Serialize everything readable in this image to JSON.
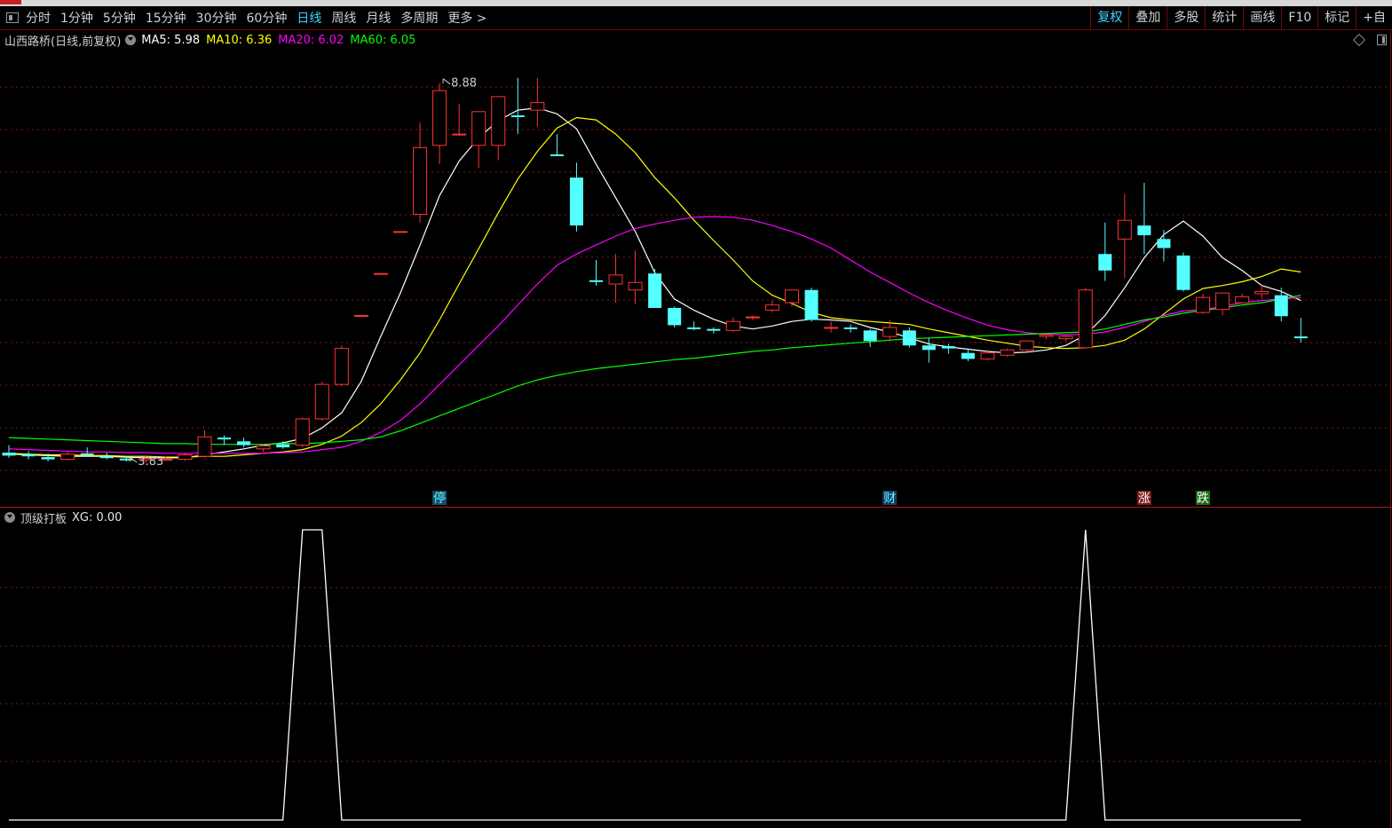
{
  "toolbar": {
    "periods": [
      "分时",
      "1分钟",
      "5分钟",
      "15分钟",
      "30分钟",
      "60分钟",
      "日线",
      "周线",
      "月线",
      "多周期",
      "更多 >"
    ],
    "active_period": "日线",
    "right_buttons": [
      "复权",
      "叠加",
      "多股",
      "统计",
      "画线",
      "F10",
      "标记",
      "+自"
    ],
    "active_right": "复权"
  },
  "info": {
    "title": "山西路桥(日线,前复权)",
    "ma": [
      {
        "label": "MA5: 5.98",
        "color": "#ffffff"
      },
      {
        "label": "MA10: 6.36",
        "color": "#ffff00"
      },
      {
        "label": "MA20: 6.02",
        "color": "#ff00ff"
      },
      {
        "label": "MA60: 6.05",
        "color": "#00ff00"
      }
    ]
  },
  "indicator": {
    "title": "顶级打板",
    "value": "XG: 0.00"
  },
  "colors": {
    "up": "#ff3232",
    "down": "#54ffff",
    "ma5": "#ffffff",
    "ma10": "#ffff00",
    "ma20": "#ff00ff",
    "ma60": "#00ff00",
    "grid": "#8b1a1a",
    "border": "#6e0a0a"
  },
  "chart_data": [
    {
      "type": "candlestick",
      "title": "山西路桥(日线,前复权)",
      "ylim": [
        3.5,
        9.35
      ],
      "price_annotations": [
        {
          "label": "8.88",
          "index": 22,
          "price": 8.88
        },
        {
          "label": "3.83",
          "index": 6,
          "price": 3.83
        }
      ],
      "candles": [
        [
          3.95,
          4.05,
          3.88,
          3.91
        ],
        [
          3.93,
          3.97,
          3.86,
          3.9
        ],
        [
          3.89,
          3.94,
          3.83,
          3.86
        ],
        [
          3.86,
          3.96,
          3.84,
          3.93
        ],
        [
          3.94,
          4.02,
          3.9,
          3.92
        ],
        [
          3.9,
          3.95,
          3.86,
          3.88
        ],
        [
          3.87,
          3.9,
          3.83,
          3.86
        ],
        [
          3.85,
          3.88,
          3.82,
          3.87
        ],
        [
          3.86,
          3.9,
          3.84,
          3.86
        ],
        [
          3.86,
          3.94,
          3.84,
          3.92
        ],
        [
          3.9,
          4.25,
          3.88,
          4.16
        ],
        [
          4.15,
          4.18,
          4.05,
          4.14
        ],
        [
          4.1,
          4.15,
          4.02,
          4.05
        ],
        [
          4.0,
          4.06,
          3.96,
          4.04
        ],
        [
          4.06,
          4.1,
          4.0,
          4.02
        ],
        [
          4.05,
          4.42,
          4.02,
          4.4
        ],
        [
          4.4,
          4.9,
          4.38,
          4.86
        ],
        [
          4.86,
          5.38,
          4.84,
          5.34
        ],
        [
          5.78,
          5.78,
          5.78,
          5.78
        ],
        [
          6.34,
          6.34,
          6.34,
          6.34
        ],
        [
          6.9,
          6.9,
          6.9,
          6.9
        ],
        [
          7.13,
          8.35,
          7.02,
          8.02
        ],
        [
          8.05,
          8.88,
          7.8,
          8.78
        ],
        [
          8.2,
          8.6,
          8.18,
          8.2
        ],
        [
          8.05,
          8.45,
          7.75,
          8.5
        ],
        [
          8.05,
          8.62,
          7.85,
          8.7
        ],
        [
          8.45,
          8.95,
          8.2,
          8.43
        ],
        [
          8.52,
          8.95,
          8.3,
          8.62
        ],
        [
          7.93,
          8.2,
          7.92,
          7.92
        ],
        [
          7.62,
          7.82,
          6.9,
          6.98
        ],
        [
          6.25,
          6.52,
          6.18,
          6.24
        ],
        [
          6.2,
          6.6,
          5.95,
          6.32
        ],
        [
          6.12,
          6.65,
          5.93,
          6.22
        ],
        [
          6.34,
          6.4,
          5.88,
          5.88
        ],
        [
          5.88,
          5.9,
          5.62,
          5.65
        ],
        [
          5.62,
          5.7,
          5.58,
          5.6
        ],
        [
          5.6,
          5.62,
          5.54,
          5.58
        ],
        [
          5.58,
          5.75,
          5.56,
          5.7
        ],
        [
          5.75,
          5.78,
          5.72,
          5.76
        ],
        [
          5.85,
          5.98,
          5.82,
          5.92
        ],
        [
          5.95,
          6.1,
          5.9,
          6.12
        ],
        [
          6.12,
          6.15,
          5.7,
          5.72
        ],
        [
          5.62,
          5.7,
          5.55,
          5.62
        ],
        [
          5.62,
          5.66,
          5.55,
          5.6
        ],
        [
          5.58,
          5.6,
          5.36,
          5.44
        ],
        [
          5.5,
          5.72,
          5.45,
          5.62
        ],
        [
          5.58,
          5.62,
          5.35,
          5.38
        ],
        [
          5.38,
          5.48,
          5.15,
          5.32
        ],
        [
          5.37,
          5.4,
          5.27,
          5.34
        ],
        [
          5.28,
          5.34,
          5.17,
          5.2
        ],
        [
          5.2,
          5.32,
          5.18,
          5.28
        ],
        [
          5.25,
          5.34,
          5.23,
          5.32
        ],
        [
          5.32,
          5.44,
          5.3,
          5.44
        ],
        [
          5.5,
          5.54,
          5.46,
          5.52
        ],
        [
          5.47,
          5.52,
          5.44,
          5.5
        ],
        [
          5.35,
          6.15,
          5.35,
          6.12
        ],
        [
          6.6,
          7.02,
          6.24,
          6.38
        ],
        [
          6.8,
          7.4,
          6.28,
          7.05
        ],
        [
          6.98,
          7.55,
          6.6,
          6.85
        ],
        [
          6.8,
          6.92,
          6.5,
          6.68
        ],
        [
          6.58,
          6.62,
          6.1,
          6.12
        ],
        [
          5.82,
          6.07,
          5.8,
          6.02
        ],
        [
          5.86,
          6.08,
          5.78,
          6.08
        ],
        [
          5.95,
          6.07,
          5.95,
          6.03
        ],
        [
          6.07,
          6.2,
          6.0,
          6.1
        ],
        [
          6.05,
          6.15,
          5.7,
          5.77
        ],
        [
          5.5,
          5.75,
          5.42,
          5.48
        ]
      ],
      "ma_series": [
        {
          "name": "MA5",
          "values": [
            3.93,
            3.92,
            3.91,
            3.9,
            3.9,
            3.9,
            3.89,
            3.88,
            3.88,
            3.88,
            3.92,
            3.96,
            4.0,
            4.05,
            4.08,
            4.14,
            4.28,
            4.48,
            4.9,
            5.5,
            6.08,
            6.72,
            7.38,
            7.84,
            8.15,
            8.38,
            8.52,
            8.55,
            8.47,
            8.27,
            7.8,
            7.35,
            6.9,
            6.35,
            6.0,
            5.85,
            5.73,
            5.64,
            5.6,
            5.64,
            5.7,
            5.73,
            5.72,
            5.7,
            5.62,
            5.56,
            5.48,
            5.4,
            5.36,
            5.33,
            5.3,
            5.28,
            5.29,
            5.32,
            5.38,
            5.52,
            5.78,
            6.15,
            6.55,
            6.86,
            7.04,
            6.84,
            6.55,
            6.38,
            6.18,
            6.1,
            5.98
          ]
        },
        {
          "name": "MA10",
          "values": [
            3.94,
            3.93,
            3.92,
            3.92,
            3.91,
            3.91,
            3.9,
            3.9,
            3.89,
            3.89,
            3.9,
            3.9,
            3.92,
            3.94,
            3.96,
            3.99,
            4.06,
            4.17,
            4.35,
            4.6,
            4.92,
            5.28,
            5.72,
            6.2,
            6.67,
            7.15,
            7.6,
            7.97,
            8.28,
            8.42,
            8.39,
            8.2,
            7.95,
            7.62,
            7.35,
            7.05,
            6.78,
            6.52,
            6.24,
            6.05,
            5.94,
            5.82,
            5.75,
            5.72,
            5.7,
            5.68,
            5.66,
            5.6,
            5.55,
            5.5,
            5.45,
            5.41,
            5.37,
            5.35,
            5.34,
            5.35,
            5.38,
            5.45,
            5.6,
            5.8,
            6.0,
            6.14,
            6.18,
            6.23,
            6.3,
            6.4,
            6.36
          ]
        },
        {
          "name": "MA20",
          "values": [
            4.0,
            3.99,
            3.98,
            3.97,
            3.96,
            3.96,
            3.95,
            3.95,
            3.94,
            3.94,
            3.94,
            3.94,
            3.94,
            3.94,
            3.95,
            3.96,
            3.99,
            4.02,
            4.1,
            4.22,
            4.38,
            4.6,
            4.86,
            5.12,
            5.38,
            5.64,
            5.92,
            6.2,
            6.45,
            6.6,
            6.72,
            6.84,
            6.94,
            7.0,
            7.05,
            7.09,
            7.1,
            7.09,
            7.05,
            6.98,
            6.9,
            6.8,
            6.68,
            6.52,
            6.36,
            6.22,
            6.08,
            5.95,
            5.84,
            5.74,
            5.65,
            5.59,
            5.55,
            5.53,
            5.52,
            5.53,
            5.56,
            5.62,
            5.7,
            5.78,
            5.84,
            5.86,
            5.9,
            5.95,
            5.98,
            6.0,
            6.02
          ]
        },
        {
          "name": "MA60",
          "values": [
            4.15,
            4.14,
            4.13,
            4.12,
            4.11,
            4.1,
            4.09,
            4.08,
            4.07,
            4.07,
            4.06,
            4.06,
            4.06,
            4.06,
            4.07,
            4.07,
            4.08,
            4.1,
            4.12,
            4.16,
            4.24,
            4.34,
            4.44,
            4.54,
            4.64,
            4.74,
            4.84,
            4.92,
            4.98,
            5.03,
            5.07,
            5.1,
            5.13,
            5.16,
            5.19,
            5.21,
            5.24,
            5.27,
            5.3,
            5.32,
            5.35,
            5.37,
            5.39,
            5.41,
            5.43,
            5.45,
            5.47,
            5.48,
            5.49,
            5.5,
            5.51,
            5.52,
            5.53,
            5.54,
            5.55,
            5.56,
            5.6,
            5.66,
            5.72,
            5.76,
            5.81,
            5.85,
            5.88,
            5.92,
            5.95,
            6.0,
            6.05
          ]
        }
      ],
      "markers": [
        {
          "label": "停",
          "index": 22,
          "color": "#54ffff",
          "bg": "#1a4a66"
        },
        {
          "label": "财",
          "index": 45,
          "color": "#54ffff",
          "bg": "#1a3a66"
        },
        {
          "label": "涨",
          "index": 58,
          "color": "#ffffff",
          "bg": "#7a1a1a"
        },
        {
          "label": "跌",
          "index": 61,
          "color": "#ffffff",
          "bg": "#1a6a1a"
        }
      ]
    },
    {
      "type": "line",
      "title": "顶级打板",
      "ylim": [
        0,
        1
      ],
      "series": [
        {
          "name": "XG",
          "values": [
            0,
            0,
            0,
            0,
            0,
            0,
            0,
            0,
            0,
            0,
            0,
            0,
            0,
            0,
            0,
            1,
            1,
            0,
            0,
            0,
            0,
            0,
            0,
            0,
            0,
            0,
            0,
            0,
            0,
            0,
            0,
            0,
            0,
            0,
            0,
            0,
            0,
            0,
            0,
            0,
            0,
            0,
            0,
            0,
            0,
            0,
            0,
            0,
            0,
            0,
            0,
            0,
            0,
            0,
            0,
            1,
            0,
            0,
            0,
            0,
            0,
            0,
            0,
            0,
            0,
            0,
            0
          ]
        }
      ]
    }
  ]
}
